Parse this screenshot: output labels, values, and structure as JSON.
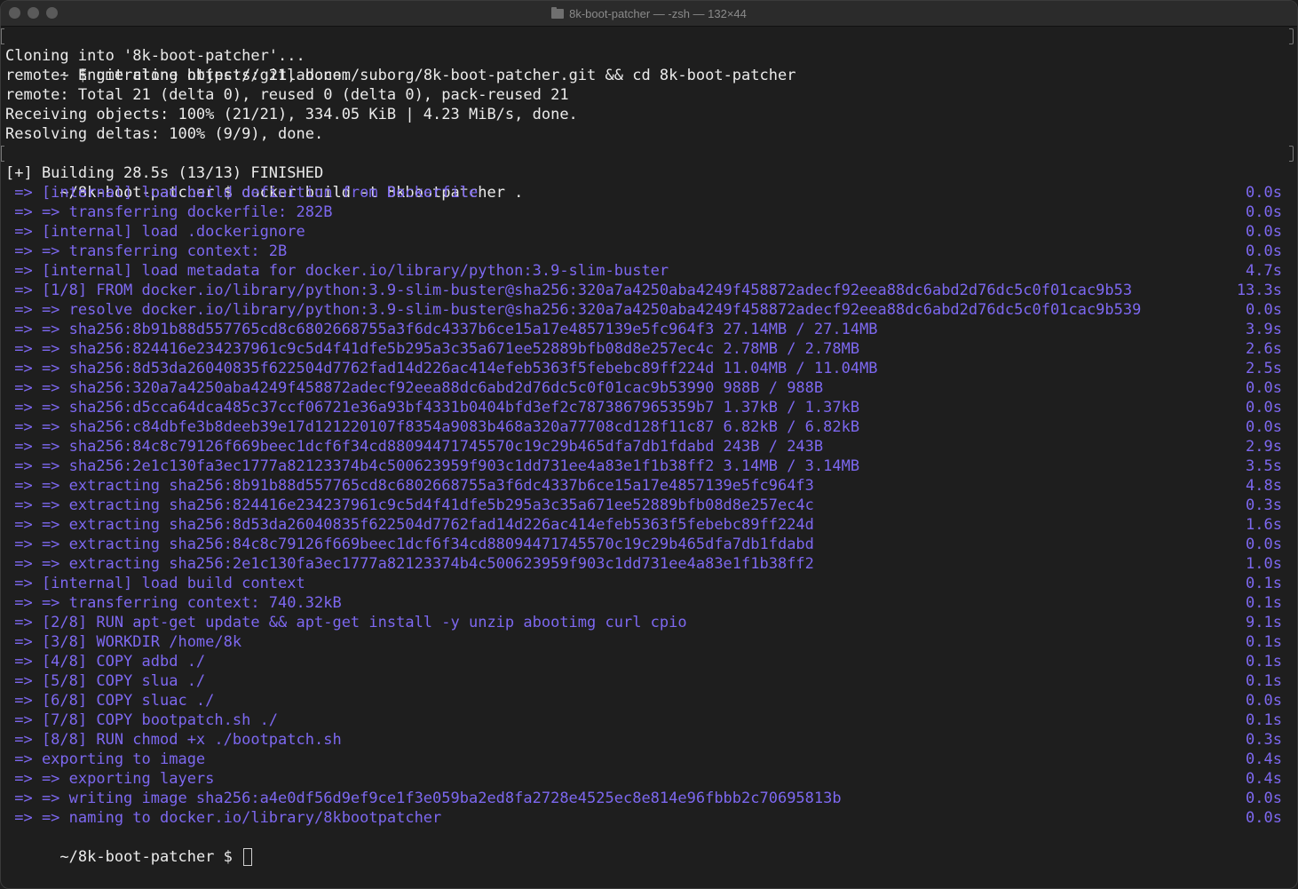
{
  "window": {
    "title": "8k-boot-patcher — -zsh — 132×44",
    "traffic_lights": [
      "close",
      "minimize",
      "zoom"
    ]
  },
  "terminal": {
    "command_lines": [
      "~ $ git clone https://gitlab.com/suborg/8k-boot-patcher.git && cd 8k-boot-patcher",
      "~/8k-boot-patcher $ docker build -t 8kbootpatcher ."
    ],
    "clone_output": [
      "Cloning into '8k-boot-patcher'...",
      "remote: Enumerating objects: 21, done.",
      "remote: Total 21 (delta 0), reused 0 (delta 0), pack-reused 21",
      "Receiving objects: 100% (21/21), 334.05 KiB | 4.23 MiB/s, done.",
      "Resolving deltas: 100% (9/9), done."
    ],
    "build_header": "[+] Building 28.5s (13/13) FINISHED",
    "build_steps": [
      {
        "text": " => [internal] load build definition from Dockerfile",
        "time": "0.0s"
      },
      {
        "text": " => => transferring dockerfile: 282B",
        "time": "0.0s"
      },
      {
        "text": " => [internal] load .dockerignore",
        "time": "0.0s"
      },
      {
        "text": " => => transferring context: 2B",
        "time": "0.0s"
      },
      {
        "text": " => [internal] load metadata for docker.io/library/python:3.9-slim-buster",
        "time": "4.7s"
      },
      {
        "text": " => [1/8] FROM docker.io/library/python:3.9-slim-buster@sha256:320a7a4250aba4249f458872adecf92eea88dc6abd2d76dc5c0f01cac9b53",
        "time": "13.3s"
      },
      {
        "text": " => => resolve docker.io/library/python:3.9-slim-buster@sha256:320a7a4250aba4249f458872adecf92eea88dc6abd2d76dc5c0f01cac9b539",
        "time": "0.0s"
      },
      {
        "text": " => => sha256:8b91b88d557765cd8c6802668755a3f6dc4337b6ce15a17e4857139e5fc964f3 27.14MB / 27.14MB",
        "time": "3.9s"
      },
      {
        "text": " => => sha256:824416e234237961c9c5d4f41dfe5b295a3c35a671ee52889bfb08d8e257ec4c 2.78MB / 2.78MB",
        "time": "2.6s"
      },
      {
        "text": " => => sha256:8d53da26040835f622504d7762fad14d226ac414efeb5363f5febebc89ff224d 11.04MB / 11.04MB",
        "time": "2.5s"
      },
      {
        "text": " => => sha256:320a7a4250aba4249f458872adecf92eea88dc6abd2d76dc5c0f01cac9b53990 988B / 988B",
        "time": "0.0s"
      },
      {
        "text": " => => sha256:d5cca64dca485c37ccf06721e36a93bf4331b0404bfd3ef2c7873867965359b7 1.37kB / 1.37kB",
        "time": "0.0s"
      },
      {
        "text": " => => sha256:c84dbfe3b8deeb39e17d121220107f8354a9083b468a320a77708cd128f11c87 6.82kB / 6.82kB",
        "time": "0.0s"
      },
      {
        "text": " => => sha256:84c8c79126f669beec1dcf6f34cd88094471745570c19c29b465dfa7db1fdabd 243B / 243B",
        "time": "2.9s"
      },
      {
        "text": " => => sha256:2e1c130fa3ec1777a82123374b4c500623959f903c1dd731ee4a83e1f1b38ff2 3.14MB / 3.14MB",
        "time": "3.5s"
      },
      {
        "text": " => => extracting sha256:8b91b88d557765cd8c6802668755a3f6dc4337b6ce15a17e4857139e5fc964f3",
        "time": "4.8s"
      },
      {
        "text": " => => extracting sha256:824416e234237961c9c5d4f41dfe5b295a3c35a671ee52889bfb08d8e257ec4c",
        "time": "0.3s"
      },
      {
        "text": " => => extracting sha256:8d53da26040835f622504d7762fad14d226ac414efeb5363f5febebc89ff224d",
        "time": "1.6s"
      },
      {
        "text": " => => extracting sha256:84c8c79126f669beec1dcf6f34cd88094471745570c19c29b465dfa7db1fdabd",
        "time": "0.0s"
      },
      {
        "text": " => => extracting sha256:2e1c130fa3ec1777a82123374b4c500623959f903c1dd731ee4a83e1f1b38ff2",
        "time": "1.0s"
      },
      {
        "text": " => [internal] load build context",
        "time": "0.1s"
      },
      {
        "text": " => => transferring context: 740.32kB",
        "time": "0.1s"
      },
      {
        "text": " => [2/8] RUN apt-get update && apt-get install -y unzip abootimg curl cpio",
        "time": "9.1s"
      },
      {
        "text": " => [3/8] WORKDIR /home/8k",
        "time": "0.1s"
      },
      {
        "text": " => [4/8] COPY adbd ./",
        "time": "0.1s"
      },
      {
        "text": " => [5/8] COPY slua ./",
        "time": "0.1s"
      },
      {
        "text": " => [6/8] COPY sluac ./",
        "time": "0.0s"
      },
      {
        "text": " => [7/8] COPY bootpatch.sh ./",
        "time": "0.1s"
      },
      {
        "text": " => [8/8] RUN chmod +x ./bootpatch.sh",
        "time": "0.3s"
      },
      {
        "text": " => exporting to image",
        "time": "0.4s"
      },
      {
        "text": " => => exporting layers",
        "time": "0.4s"
      },
      {
        "text": " => => writing image sha256:a4e0df56d9ef9ce1f3e059ba2ed8fa2728e4525ec8e814e96fbbb2c70695813b",
        "time": "0.0s"
      },
      {
        "text": " => => naming to docker.io/library/8kbootpatcher",
        "time": "0.0s"
      }
    ],
    "prompt": "~/8k-boot-patcher $ "
  },
  "colors": {
    "background": "#1e1e1e",
    "text": "#ebebeb",
    "build_step": "#7d68f0"
  }
}
